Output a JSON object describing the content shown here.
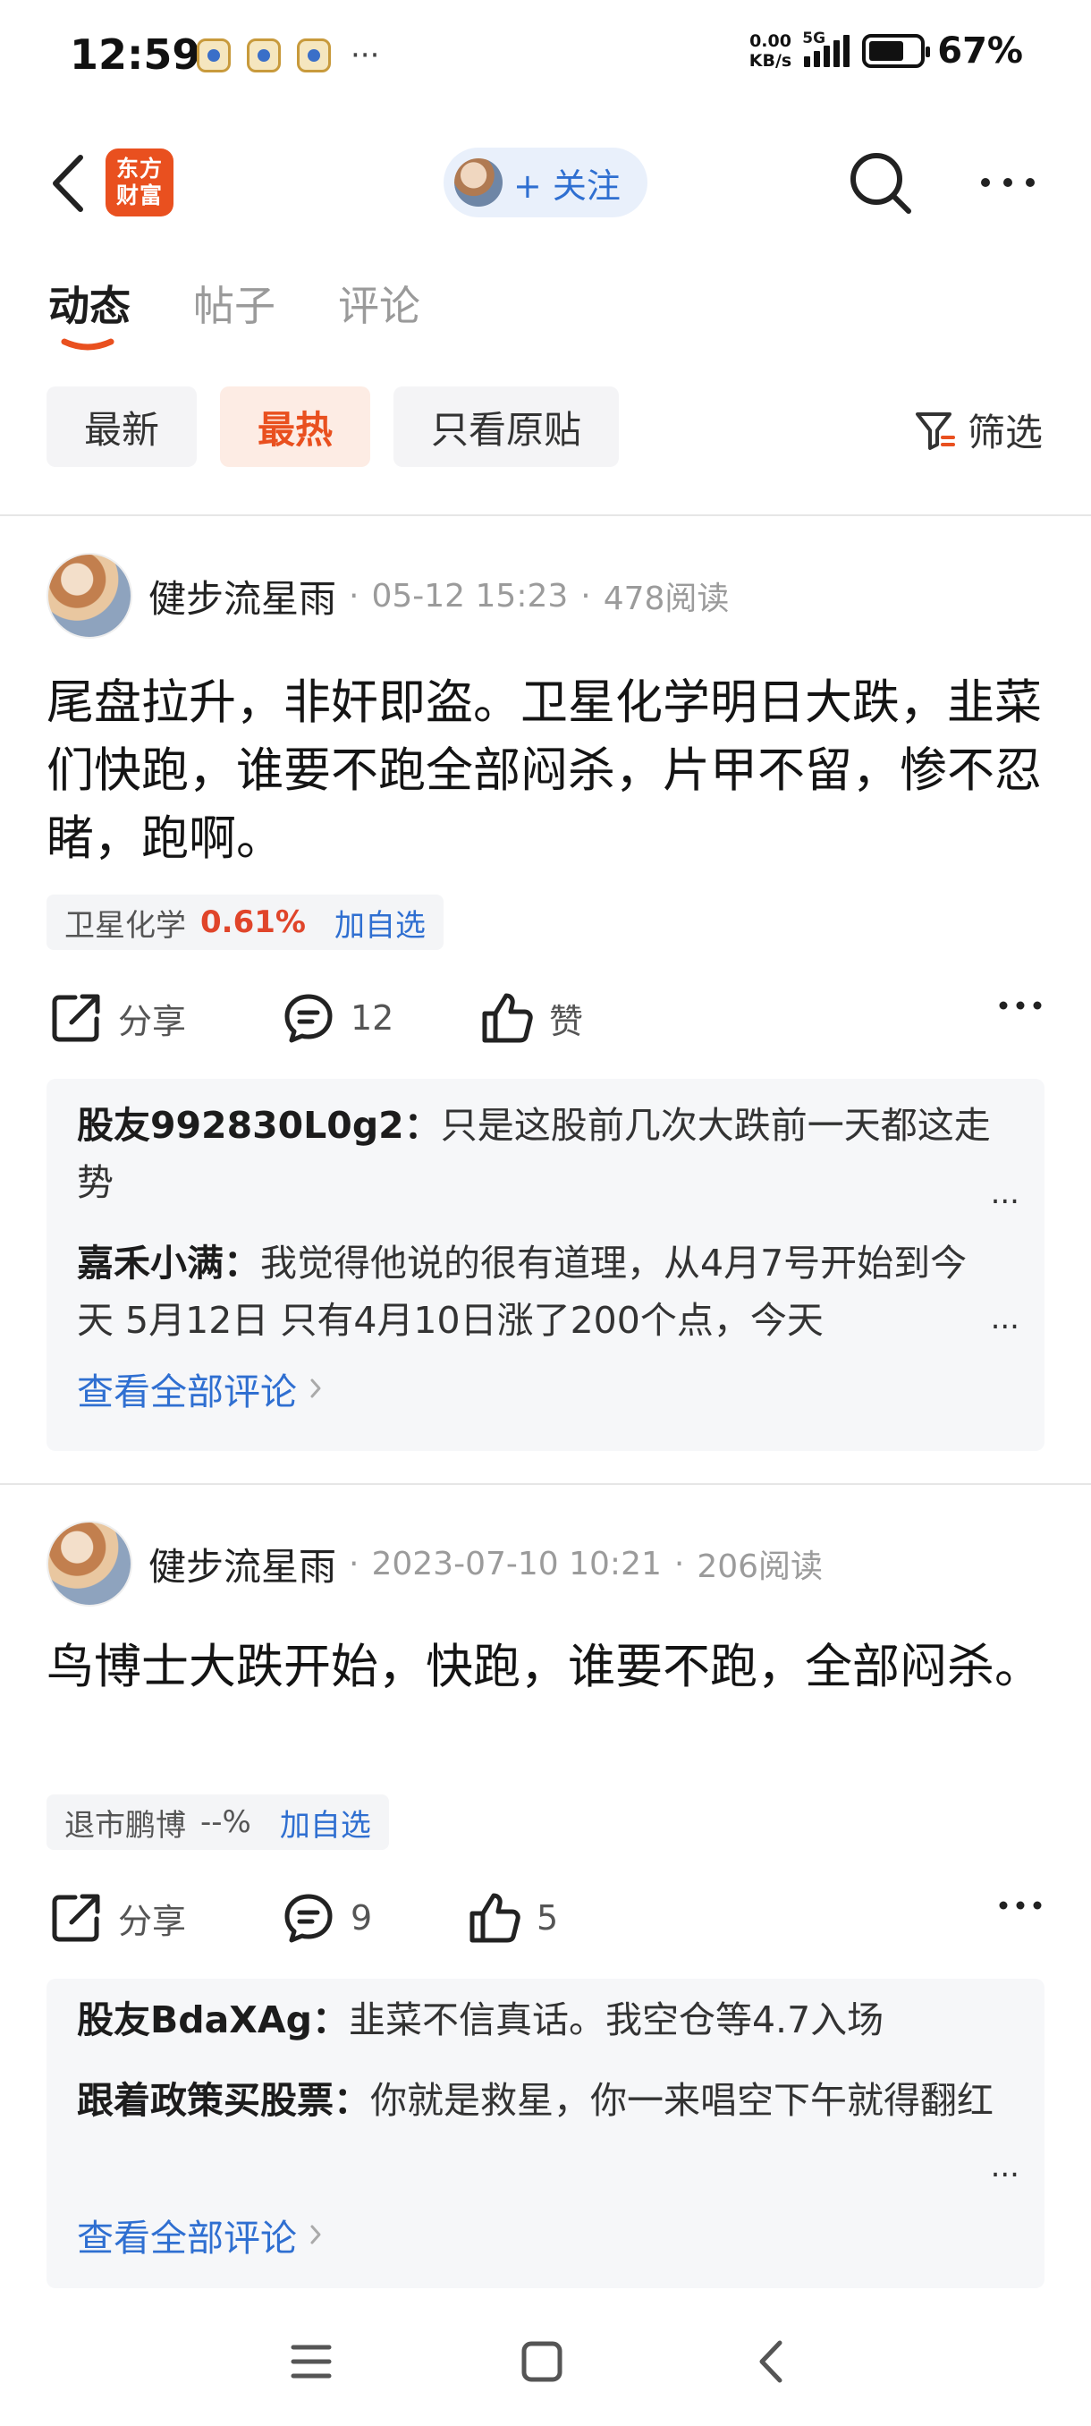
{
  "status_bar": {
    "time": "12:59",
    "more": "···",
    "net_speed_value": "0.00",
    "net_speed_unit": "KB/s",
    "network": "5G",
    "battery": "67%"
  },
  "header": {
    "brand_line1": "东方",
    "brand_line2": "财富",
    "follow_label": "+ 关注"
  },
  "tabs": [
    {
      "label": "动态",
      "active": true
    },
    {
      "label": "帖子",
      "active": false
    },
    {
      "label": "评论",
      "active": false
    }
  ],
  "filters": {
    "chips": [
      {
        "label": "最新",
        "active": false
      },
      {
        "label": "最热",
        "active": true
      },
      {
        "label": "只看原贴",
        "active": false
      }
    ],
    "filter_label": "筛选"
  },
  "posts": [
    {
      "author": "健步流星雨",
      "date": "05-12 15:23",
      "reads": "478阅读",
      "text": "尾盘拉升，非奸即盗。卫星化学明日大跌，韭菜们快跑，谁要不跑全部闷杀，片甲不留，惨不忍睹，跑啊。",
      "stock": {
        "name": "卫星化学",
        "change": "0.61%",
        "add": "加自选"
      },
      "share_label": "分享",
      "comment_count": "12",
      "like_label": "赞",
      "comments": [
        {
          "user": "股友992830L0g2",
          "sep": "：",
          "text": "只是这股前几次大跌前一天都这走势"
        },
        {
          "user": "嘉禾小满",
          "sep": "：",
          "text": "我觉得他说的很有道理，从4月7号开始到今天 5月12日 只有4月10日涨了200个点，今天"
        }
      ],
      "more_marker": "...",
      "view_all": "查看全部评论"
    },
    {
      "author": "健步流星雨",
      "date": "2023-07-10 10:21",
      "reads": "206阅读",
      "text": "鸟博士大跌开始，快跑，谁要不跑，全部闷杀。",
      "stock": {
        "name": "退市鹏博",
        "change": "--%",
        "add": "加自选"
      },
      "share_label": "分享",
      "comment_count": "9",
      "like_label": "5",
      "comments": [
        {
          "user": "股友BdaXAg",
          "sep": "：",
          "text": "韭菜不信真话。我空仓等4.7入场"
        },
        {
          "user": "跟着政策买股票",
          "sep": "：",
          "text": "你就是救星，你一来唱空下午就得翻红"
        }
      ],
      "more_marker": "...",
      "view_all": "查看全部评论"
    }
  ],
  "colors": {
    "accent_orange": "#e9501f",
    "link_blue": "#2f6fd1",
    "stock_red": "#e0452a"
  }
}
